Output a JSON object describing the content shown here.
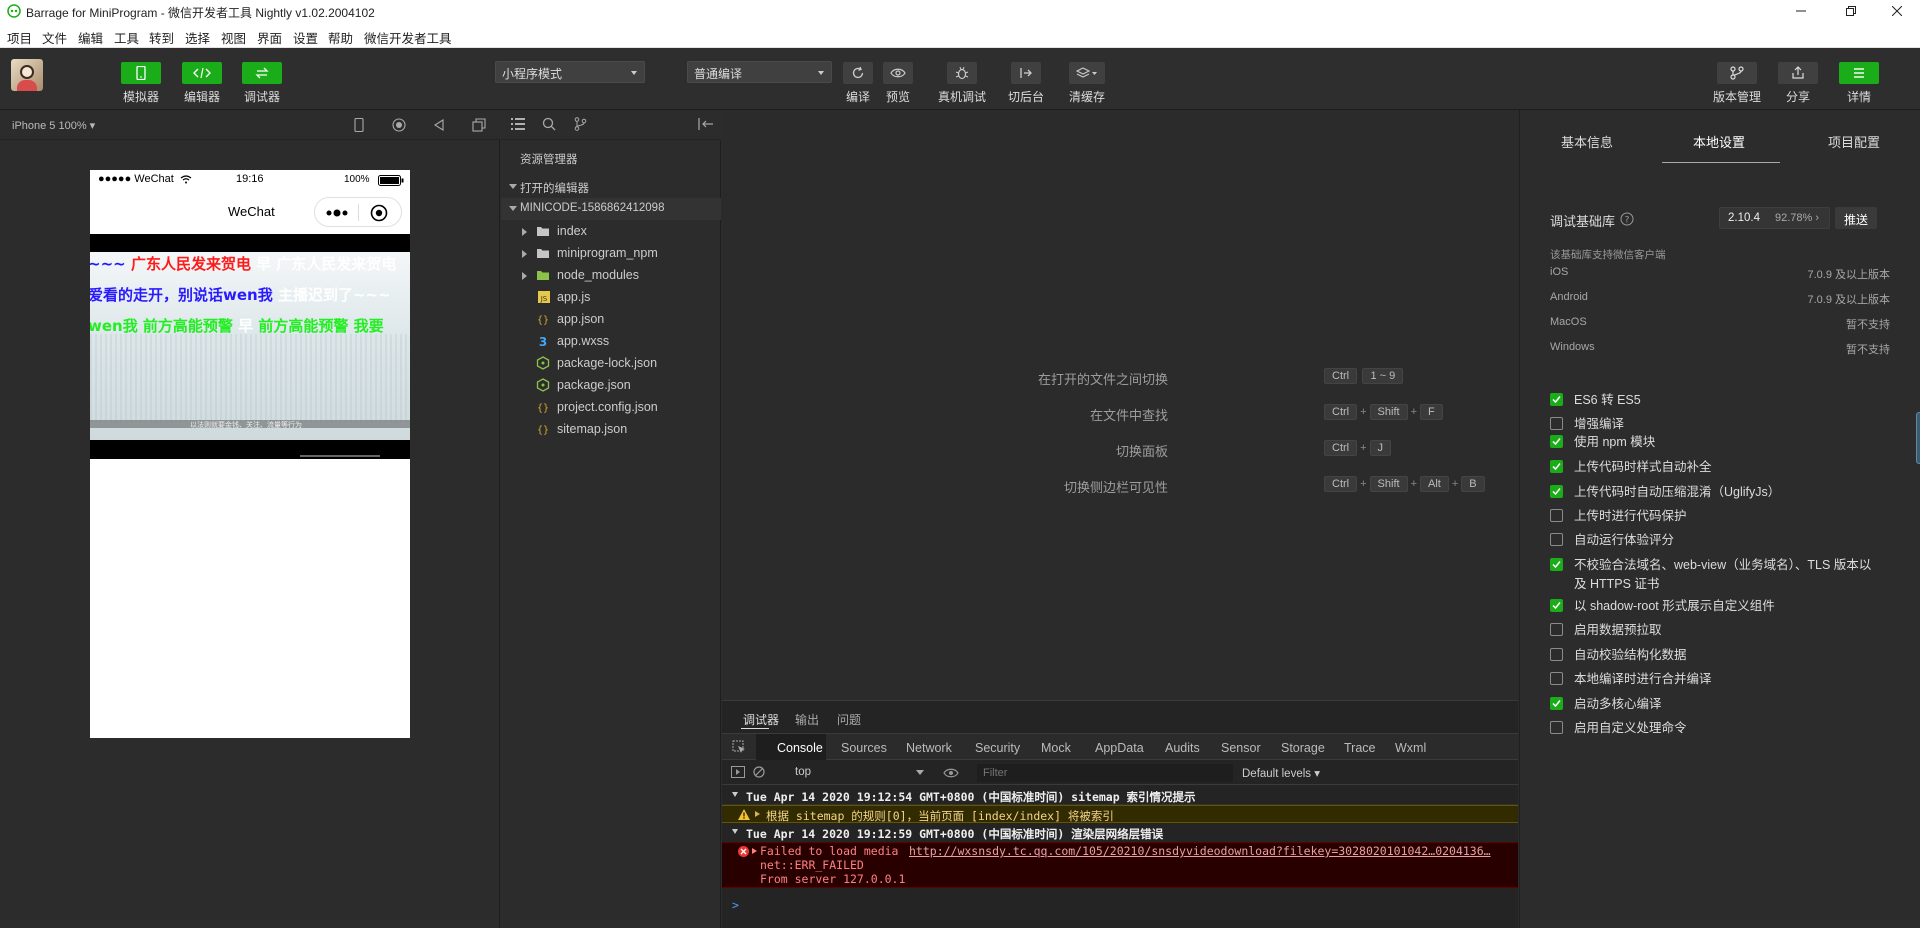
{
  "window": {
    "title": "Barrage for MiniProgram - 微信开发者工具 Nightly v1.02.2004102"
  },
  "menu": [
    "项目",
    "文件",
    "编辑",
    "工具",
    "转到",
    "选择",
    "视图",
    "界面",
    "设置",
    "帮助",
    "微信开发者工具"
  ],
  "toolbar": {
    "left": [
      {
        "label": "模拟器",
        "icon": "phone-icon"
      },
      {
        "label": "编辑器",
        "icon": "code-icon"
      },
      {
        "label": "调试器",
        "icon": "debug-icon"
      }
    ],
    "mode_select": "小程序模式",
    "compile_select": "普通编译",
    "actions": [
      {
        "label": "编译",
        "icon": "refresh-icon"
      },
      {
        "label": "预览",
        "icon": "eye-icon"
      },
      {
        "label": "真机调试",
        "icon": "bug-icon"
      },
      {
        "label": "切后台",
        "icon": "background-icon"
      },
      {
        "label": "清缓存",
        "icon": "layers-icon"
      }
    ],
    "right": [
      {
        "label": "版本管理",
        "icon": "version-icon"
      },
      {
        "label": "分享",
        "icon": "share-icon"
      },
      {
        "label": "详情",
        "icon": "menu-icon"
      }
    ]
  },
  "simulator": {
    "device": "iPhone 5 100% ▾",
    "status": {
      "carrier": "●●●●● WeChat",
      "time": "19:16",
      "battery": "100%"
    },
    "nav_title": "WeChat",
    "barrages": [
      {
        "text": "~~~ 广东人民发来贺电 早 广东人民发来贺电",
        "color": "#1a1aff"
      },
      {
        "text": "爱看的走开，别说话wen我 主播迟到了~~~",
        "color": "#2a1aff"
      },
      {
        "text": "wen我 前方高能预警 早 前方高能预警 我要",
        "color": "#22ee22"
      }
    ],
    "video_caption": "以法则就要金钱、关注、流量等行为"
  },
  "explorer": {
    "title": "资源管理器",
    "open_editors": "打开的编辑器",
    "project": "MINICODE-1586862412098",
    "items": [
      {
        "name": "index",
        "type": "folder"
      },
      {
        "name": "miniprogram_npm",
        "type": "folder"
      },
      {
        "name": "node_modules",
        "type": "folder-green"
      },
      {
        "name": "app.js",
        "type": "js"
      },
      {
        "name": "app.json",
        "type": "json"
      },
      {
        "name": "app.wxss",
        "type": "css"
      },
      {
        "name": "package-lock.json",
        "type": "npm"
      },
      {
        "name": "package.json",
        "type": "npm"
      },
      {
        "name": "project.config.json",
        "type": "json"
      },
      {
        "name": "sitemap.json",
        "type": "json"
      }
    ]
  },
  "shortcuts": [
    {
      "label": "在打开的文件之间切换",
      "keys": [
        "Ctrl",
        "1 ~ 9"
      ]
    },
    {
      "label": "在文件中查找",
      "keys": [
        "Ctrl",
        "Shift",
        "F"
      ]
    },
    {
      "label": "切换面板",
      "keys": [
        "Ctrl",
        "J"
      ]
    },
    {
      "label": "切换侧边栏可见性",
      "keys": [
        "Ctrl",
        "Shift",
        "Alt",
        "B"
      ]
    }
  ],
  "devtools": {
    "tabs": [
      "调试器",
      "输出",
      "问题"
    ],
    "console_tabs": [
      "Console",
      "Sources",
      "Network",
      "Security",
      "Mock",
      "AppData",
      "Audits",
      "Sensor",
      "Storage",
      "Trace",
      "Wxml"
    ],
    "context": "top",
    "filter_placeholder": "Filter",
    "levels": "Default levels ▾",
    "logs": {
      "group1": "Tue Apr 14 2020 19:12:54 GMT+0800 (中国标准时间) sitemap 索引情况提示",
      "warn": "根据 sitemap 的规则[0]，当前页面 [index/index] 将被索引",
      "group2": "Tue Apr 14 2020 19:12:59 GMT+0800 (中国标准时间) 渲染层网络层错误",
      "error_prefix": "Failed to load media ",
      "error_link": "http://wxsnsdy.tc.qq.com/105/20210/snsdyvideodownload?filekey=3028020101042…0204136…",
      "error_line2": "net::ERR_FAILED",
      "error_line3": "From server 127.0.0.1",
      "prompt": ">"
    }
  },
  "settings": {
    "tabs": [
      "基本信息",
      "本地设置",
      "项目配置"
    ],
    "lib_label": "调试基础库",
    "lib_version": "2.10.4",
    "lib_percent": "92.78% ›",
    "push_label": "推送",
    "support_title": "该基础库支持微信客户端",
    "support": [
      {
        "os": "iOS",
        "value": "7.0.9 及以上版本"
      },
      {
        "os": "Android",
        "value": "7.0.9 及以上版本"
      },
      {
        "os": "MacOS",
        "value": "暂不支持"
      },
      {
        "os": "Windows",
        "value": "暂不支持"
      }
    ],
    "options": [
      {
        "label": "ES6 转 ES5",
        "checked": true
      },
      {
        "label": "增强编译",
        "checked": false
      },
      {
        "label": "使用 npm 模块",
        "checked": true
      },
      {
        "label": "上传代码时样式自动补全",
        "checked": true
      },
      {
        "label": "上传代码时自动压缩混淆（UglifyJs）",
        "checked": true
      },
      {
        "label": "上传时进行代码保护",
        "checked": false
      },
      {
        "label": "自动运行体验评分",
        "checked": false
      },
      {
        "label": "不校验合法域名、web-view（业务域名）、TLS 版本以及 HTTPS 证书",
        "checked": true
      },
      {
        "label": "以 shadow-root 形式展示自定义组件",
        "checked": true
      },
      {
        "label": "启用数据预拉取",
        "checked": false
      },
      {
        "label": "自动校验结构化数据",
        "checked": false
      },
      {
        "label": "本地编译时进行合并编译",
        "checked": false
      },
      {
        "label": "启动多核心编译",
        "checked": true
      },
      {
        "label": "启用自定义处理命令",
        "checked": false
      }
    ]
  },
  "colors": {
    "accent": "#1aad19",
    "warn_bg": "#332b00",
    "error_bg": "#290000",
    "link": "#e8a0a0"
  }
}
